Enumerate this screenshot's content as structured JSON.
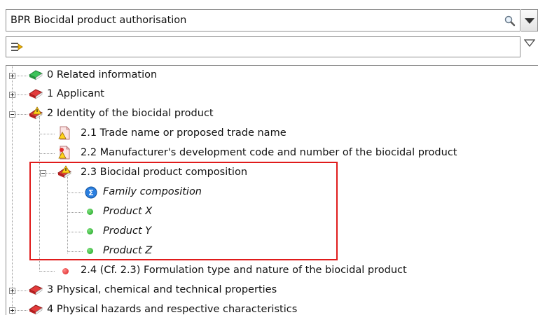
{
  "template_select": {
    "value": "BPR Biocidal product authorisation"
  },
  "tree": {
    "items": [
      {
        "label": "0 Related information"
      },
      {
        "label": "1 Applicant"
      },
      {
        "label": "2 Identity of the biocidal product"
      },
      {
        "label": "2.1 Trade name or proposed trade name"
      },
      {
        "label": "2.2 Manufacturer's development code and number of the biocidal product"
      },
      {
        "label": "2.3 Biocidal product composition"
      },
      {
        "label": "Family composition"
      },
      {
        "label": "Product X"
      },
      {
        "label": "Product Y"
      },
      {
        "label": "Product Z"
      },
      {
        "label": "2.4 (Cf. 2.3) Formulation type and nature of the biocidal product"
      },
      {
        "label": "3 Physical, chemical and technical properties"
      },
      {
        "label": "4 Physical hazards and respective characteristics"
      }
    ]
  },
  "colors": {
    "highlight": "#e01b1b",
    "book_green": "#2aa84a",
    "book_red": "#c8202a"
  }
}
